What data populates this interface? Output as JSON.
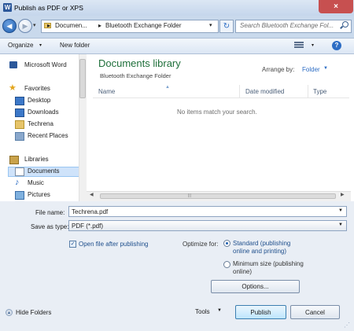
{
  "window": {
    "title": "Publish as PDF or XPS",
    "close_label": "×"
  },
  "address": {
    "segment1": "Documen...",
    "separator": "▸",
    "segment2": "Bluetooth Exchange Folder"
  },
  "search": {
    "placeholder": "Search Bluetooth Exchange Fol..."
  },
  "toolbar": {
    "organize_label": "Organize",
    "new_folder_label": "New folder",
    "caret": "▾",
    "help": "?"
  },
  "nav": {
    "items": [
      {
        "label": "Microsoft Word",
        "icon": "word-icon"
      },
      {
        "label": "Favorites",
        "icon": "star-icon"
      },
      {
        "label": "Desktop",
        "icon": "desktop-icon"
      },
      {
        "label": "Downloads",
        "icon": "downloads-icon"
      },
      {
        "label": "Techrena",
        "icon": "folder-icon"
      },
      {
        "label": "Recent Places",
        "icon": "recent-places-icon"
      },
      {
        "label": "Libraries",
        "icon": "libraries-icon"
      },
      {
        "label": "Documents",
        "icon": "documents-icon"
      },
      {
        "label": "Music",
        "icon": "music-icon"
      },
      {
        "label": "Pictures",
        "icon": "pictures-icon"
      }
    ],
    "selected": "Documents"
  },
  "library": {
    "title": "Documents library",
    "subtitle": "Bluetooth Exchange Folder",
    "arrange_label": "Arrange by:",
    "arrange_value": "Folder"
  },
  "columns": {
    "name": "Name",
    "date_modified": "Date modified",
    "type": "Type"
  },
  "empty_message": "No items match your search.",
  "form": {
    "filename_label": "File name:",
    "filename_value": "Techrena.pdf",
    "savetype_label": "Save as type:",
    "savetype_value": "PDF (*.pdf)",
    "open_after_label": "Open file after publishing",
    "optimize_label": "Optimize for:",
    "standard_label": "Standard (publishing online and printing)",
    "minimum_label": "Minimum size (publishing online)",
    "options_label": "Options...",
    "hide_folders_label": "Hide Folders",
    "tools_label": "Tools",
    "publish_label": "Publish",
    "cancel_label": "Cancel"
  },
  "colors": {
    "accent": "#2d6dc4",
    "library_title": "#1e6f3a",
    "selection": "#cfe3fa"
  }
}
